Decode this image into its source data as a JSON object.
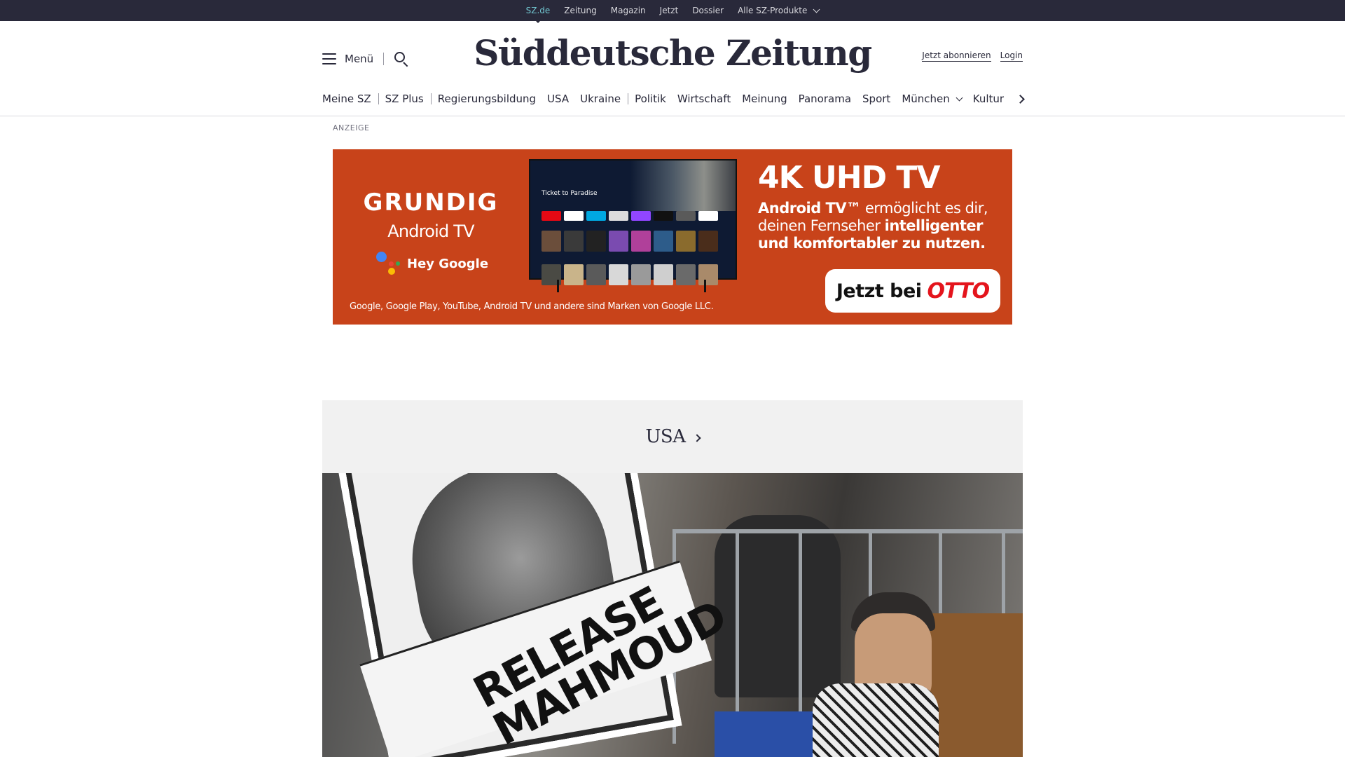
{
  "topbar": {
    "links": [
      "SZ.de",
      "Zeitung",
      "Magazin",
      "Jetzt",
      "Dossier",
      "Alle SZ-Produkte"
    ]
  },
  "header": {
    "menu_label": "Menü",
    "logo": "Süddeutsche Zeitung",
    "subscribe": "Jetzt abonnieren",
    "login": "Login"
  },
  "nav": {
    "items": [
      "Meine SZ",
      "SZ Plus",
      "Regierungsbildung",
      "USA",
      "Ukraine",
      "Politik",
      "Wirtschaft",
      "Meinung",
      "Panorama",
      "Sport",
      "München",
      "Kultur"
    ]
  },
  "ad": {
    "label": "ANZEIGE",
    "brand": "GRUNDIG",
    "android_tv": "Android TV",
    "hey_google": "Hey Google",
    "tv_title": "Ticket to Paradise",
    "headline": "4K UHD TV",
    "copy_bold_1": "Android TV™",
    "copy_1": " ermöglicht es dir, deinen Fernseher ",
    "copy_bold_2": "intelligenter und komfortabler zu nutzen.",
    "cta_prefix": "Jetzt bei",
    "cta_brand": "OTTO",
    "disclaimer": "Google, Google Play, YouTube, Android TV und andere sind Marken von Google LLC.",
    "bg_color": "#c8431a"
  },
  "section": {
    "title": "USA"
  },
  "article": {
    "poster_text": "RELEASE\nMAHMOUD"
  },
  "colors": {
    "topbar_bg": "#29293a",
    "topbar_active": "#71c5cf",
    "text": "#29293a"
  }
}
